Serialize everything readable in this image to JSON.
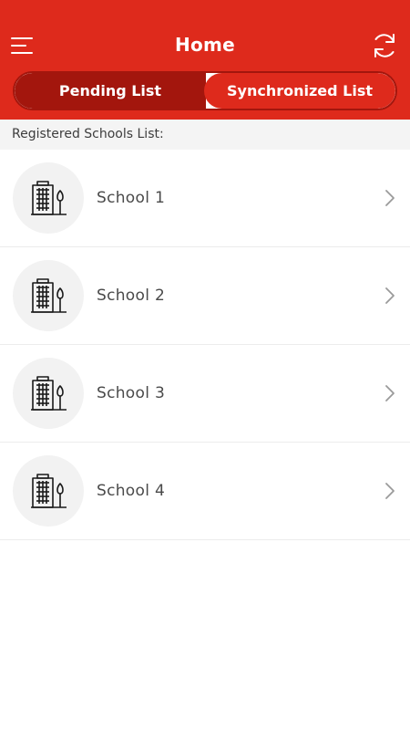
{
  "header": {
    "title": "Home",
    "bg_color": "#de2a1c",
    "menu_icon": "hamburger-icon",
    "sync_icon": "sync-icon"
  },
  "tabs": [
    {
      "label": "Pending List",
      "active": true
    },
    {
      "label": "Synchronized List",
      "active": false
    }
  ],
  "section": {
    "label": "Registered Schools List:"
  },
  "schools": [
    {
      "name": "School 1",
      "icon": "school-building-icon"
    },
    {
      "name": "School 2",
      "icon": "school-building-icon"
    },
    {
      "name": "School 3",
      "icon": "school-building-icon"
    },
    {
      "name": "School 4",
      "icon": "school-building-icon"
    }
  ]
}
